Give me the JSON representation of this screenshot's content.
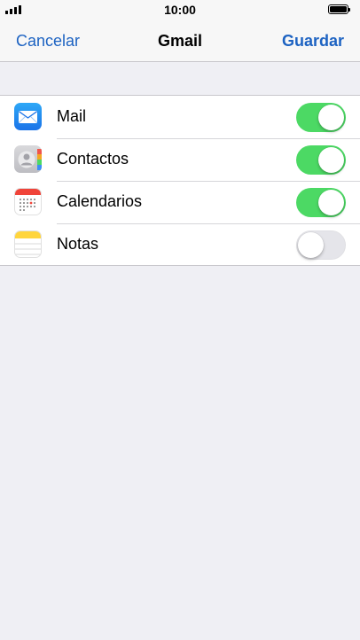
{
  "status_bar": {
    "time": "10:00"
  },
  "nav": {
    "cancel_label": "Cancelar",
    "title": "Gmail",
    "save_label": "Guardar"
  },
  "accent_color": "#1d63c2",
  "toggle_on_color": "#4cd964",
  "rows": [
    {
      "label": "Mail",
      "icon": "mail-icon",
      "enabled": true
    },
    {
      "label": "Contactos",
      "icon": "contacts-icon",
      "enabled": true
    },
    {
      "label": "Calendarios",
      "icon": "calendar-icon",
      "enabled": true
    },
    {
      "label": "Notas",
      "icon": "notes-icon",
      "enabled": false
    }
  ]
}
